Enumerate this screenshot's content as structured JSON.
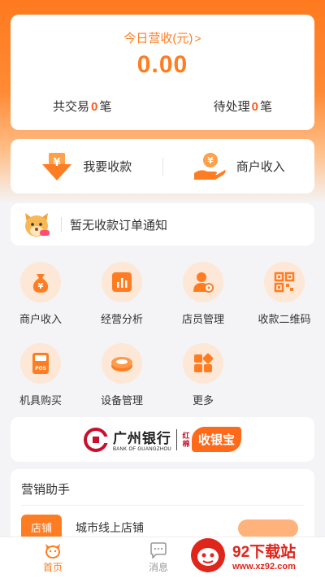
{
  "revenue": {
    "title": "今日营收(元)",
    "chevron": ">",
    "amount": "0.00",
    "trades_prefix": "共交易",
    "trades_count": "0",
    "trades_suffix": "笔",
    "pending_prefix": "待处理",
    "pending_count": "0",
    "pending_suffix": "笔"
  },
  "actions": {
    "collect_label": "我要收款",
    "merchant_income_label": "商户收入"
  },
  "notice": {
    "text": "暂无收款订单通知"
  },
  "grid": {
    "items": [
      {
        "label": "商户收入",
        "icon": "money-bag-icon"
      },
      {
        "label": "经营分析",
        "icon": "chart-icon"
      },
      {
        "label": "店员管理",
        "icon": "staff-icon"
      },
      {
        "label": "收款二维码",
        "icon": "qrcode-icon"
      },
      {
        "label": "机具购买",
        "icon": "pos-icon"
      },
      {
        "label": "设备管理",
        "icon": "device-icon"
      },
      {
        "label": "更多",
        "icon": "more-icon"
      }
    ]
  },
  "bank": {
    "name": "广州银行",
    "english": "BANK OF GUANGZHOU",
    "tag": "红棉",
    "product": "收银宝"
  },
  "marketing": {
    "title": "营销助手",
    "store_tag": "店铺",
    "store_text": "城市线上店铺"
  },
  "tabs": {
    "home": "首页",
    "message": "消息"
  },
  "watermark": {
    "title": "92下载站",
    "url": "www.xz92.com"
  },
  "colors": {
    "accent": "#ff7d22",
    "icon_bg": "#fde7d6",
    "watermark": "#e0251b"
  }
}
